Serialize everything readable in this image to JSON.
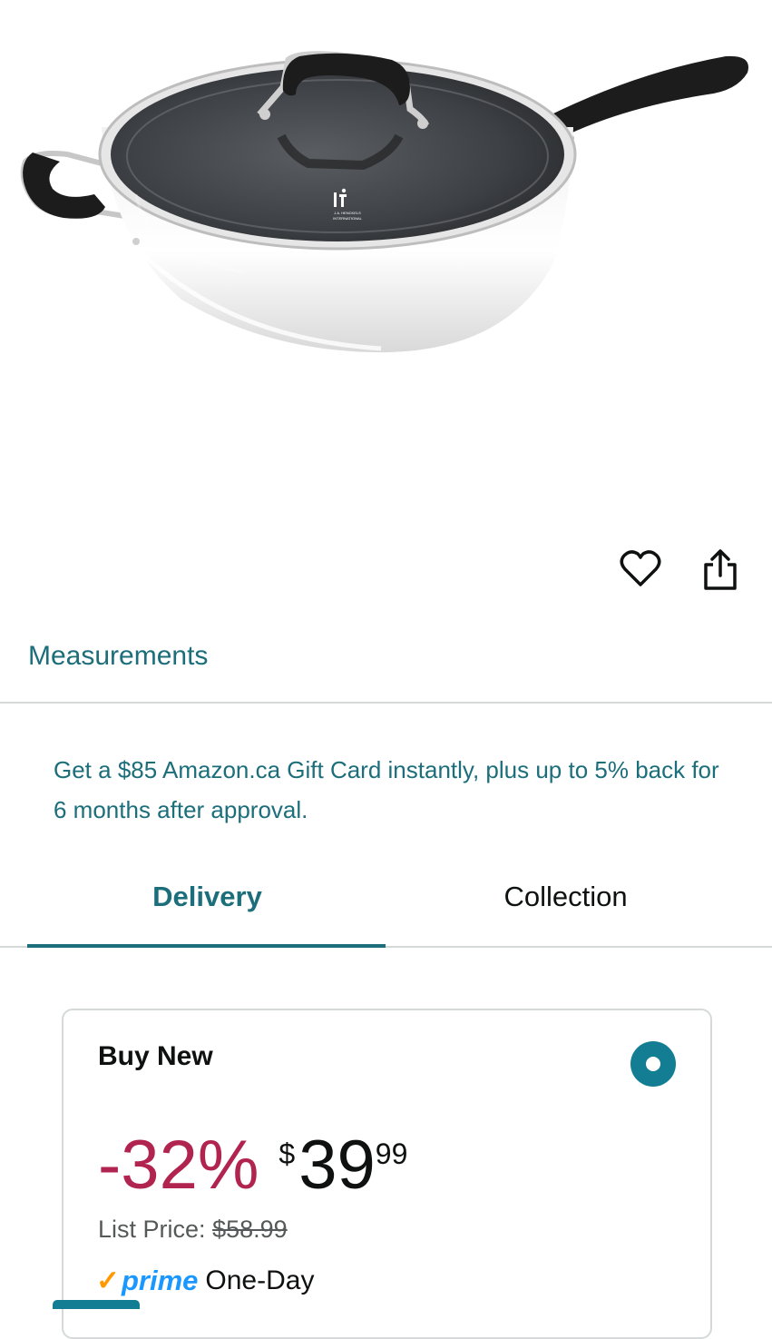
{
  "product_image": {
    "alt": "Saute pan with glass lid",
    "lid_logo_line1": "J.A. HENCKELS",
    "lid_logo_line2": "INTERNATIONAL"
  },
  "actions": {
    "wishlist_icon": "heart-icon",
    "share_icon": "share-icon"
  },
  "measurements_link": "Measurements",
  "promo_text": "Get a $85 Amazon.ca Gift Card instantly, plus up to 5% back for 6 months after approval.",
  "tabs": [
    {
      "label": "Delivery",
      "selected": true
    },
    {
      "label": "Collection",
      "selected": false
    }
  ],
  "buy_box": {
    "title": "Buy New",
    "discount": "-32%",
    "currency": "$",
    "price_whole": "39",
    "price_fraction": "99",
    "list_price_label": "List Price:",
    "list_price_value": "$58.99",
    "prime_check": "✓",
    "prime_word": "prime",
    "delivery_speed": "One-Day"
  },
  "colors": {
    "accent": "#1b6e7a",
    "discount": "#b12450",
    "radio": "#127d93",
    "prime_blue": "#1a98ff",
    "prime_check": "#ff9900"
  }
}
